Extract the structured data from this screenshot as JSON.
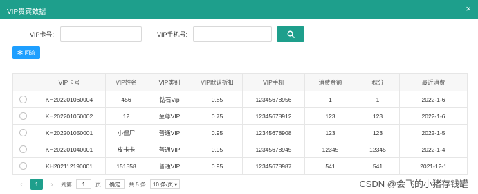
{
  "window": {
    "title": "VIP贵宾数据",
    "close_icon": "×"
  },
  "search": {
    "card_label": "VIP卡号:",
    "card_value": "",
    "phone_label": "VIP手机号:",
    "phone_value": "",
    "search_icon": "search-icon"
  },
  "toolbar": {
    "back_label": "回滚",
    "back_icon": "snowflake-icon"
  },
  "table": {
    "columns": [
      "",
      "VIP卡号",
      "VIP姓名",
      "VIP类别",
      "VIP默认折扣",
      "VIP手机",
      "消费金额",
      "积分",
      "最近消费"
    ],
    "rows": [
      [
        "KH202201060004",
        "456",
        "钻石Vip",
        "0.85",
        "12345678956",
        "1",
        "1",
        "2022-1-6"
      ],
      [
        "KH202201060002",
        "12",
        "至尊VIP",
        "0.75",
        "12345678912",
        "123",
        "123",
        "2022-1-6"
      ],
      [
        "KH202201050001",
        "小僵尸",
        "普通VIP",
        "0.95",
        "12345678908",
        "123",
        "123",
        "2022-1-5"
      ],
      [
        "KH202201040001",
        "皮卡卡",
        "普通VIP",
        "0.95",
        "12345678945",
        "12345",
        "12345",
        "2022-1-4"
      ],
      [
        "KH202112190001",
        "151558",
        "普通VIP",
        "0.95",
        "12345678987",
        "541",
        "541",
        "2021-12-1"
      ]
    ]
  },
  "pager": {
    "prev": "‹",
    "current_page": "1",
    "next": "›",
    "goto_label": "到第",
    "goto_value": "1",
    "page_unit": "页",
    "confirm": "确定",
    "total": "共 5 条",
    "page_size": "10 条/页",
    "dropdown": "▾"
  },
  "watermark": "CSDN @会飞的小猪存钱罐"
}
